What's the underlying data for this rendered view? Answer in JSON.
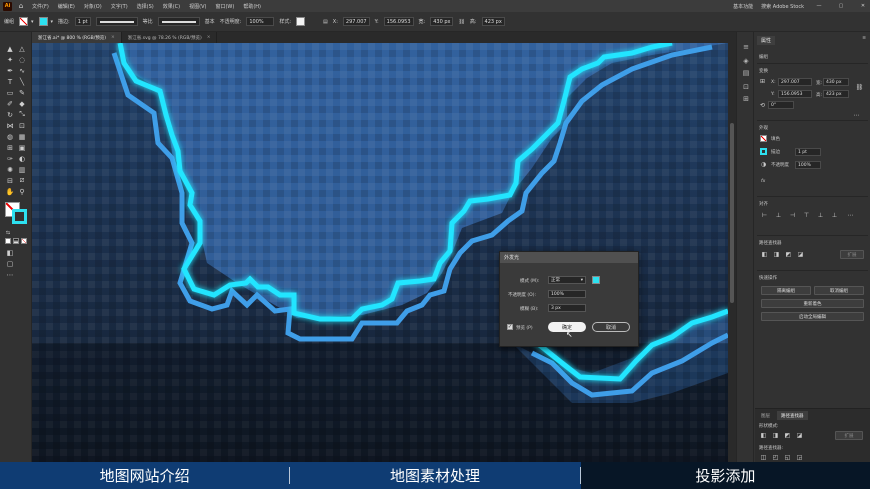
{
  "menubar": {
    "logo": "Ai",
    "items": [
      "文件(F)",
      "编辑(E)",
      "对象(O)",
      "文字(T)",
      "选择(S)",
      "效果(C)",
      "视图(V)",
      "窗口(W)",
      "帮助(H)"
    ],
    "right": [
      "基本功能",
      "搜索 Adobe Stock"
    ],
    "window_buttons": [
      "—",
      "▢",
      "✕"
    ]
  },
  "controlbar": {
    "selection": "编组",
    "stroke_label": "描边:",
    "stroke_value": "1 pt",
    "profile_label": "等比",
    "brush_label": "基本",
    "opacity_label": "不透明度:",
    "opacity_value": "100%",
    "style_label": "样式:",
    "x_label": "X:",
    "x_value": "297.007",
    "y_label": "Y:",
    "y_value": "156.0953",
    "w_label": "宽:",
    "w_value": "430 px",
    "h_label": "高:",
    "h_value": "423 px"
  },
  "tabs": [
    {
      "label": "浙江省.ai* @ 800 % (RGB/预览)",
      "close": "×",
      "active": true
    },
    {
      "label": "浙江省.svg @ 78.26 % (RGB/预览)",
      "close": "×",
      "active": false
    }
  ],
  "panel": {
    "tabs": [
      "属性"
    ],
    "group_label": "编组",
    "transform_title": "变换",
    "x_label": "X:",
    "x_value": "297.007",
    "y_label": "Y:",
    "y_value": "156.0953",
    "w_label": "宽:",
    "w_value": "430 px",
    "h_label": "高:",
    "h_value": "423 px",
    "rotate_value": "0°",
    "appearance_title": "外观",
    "fill_label": "填色",
    "stroke_label": "描边",
    "stroke_value": "1 pt",
    "opacity_label": "不透明度",
    "opacity_value": "100%",
    "fx_label": "fx",
    "align_title": "对齐",
    "pathfinder_title": "路径查找器",
    "pathfinder_expand": "扩展",
    "quick_title": "快速操作",
    "btn_isolate": "隔离编组",
    "btn_ungroup": "取消编组",
    "btn_recolor": "重新着色",
    "btn_tracing": "启动全局编辑",
    "bottom_tabs": [
      "图层",
      "路径查找器"
    ],
    "shape_mode_label": "形状模式:",
    "bottom_expand": "扩展",
    "bottom_pathfinder_label": "路径查找器:"
  },
  "dialog": {
    "title": "外发光",
    "mode_label": "模式 (M):",
    "mode_value": "正常",
    "opacity_label": "不透明度 (O):",
    "opacity_value": "100%",
    "blur_label": "模糊 (B):",
    "blur_value": "3 px",
    "preview_label": "预览 (P)",
    "ok_label": "确定",
    "cancel_label": "取消",
    "glow_color": "#2de1f0"
  },
  "bottombar": {
    "items": [
      "地图网站介绍",
      "地图素材处理",
      "投影添加"
    ],
    "active_index": 2
  },
  "colors": {
    "stroke_cyan": "#22e5ff",
    "shadow_blue": "#3f9ee8",
    "nav_blue": "#0f3c73"
  }
}
